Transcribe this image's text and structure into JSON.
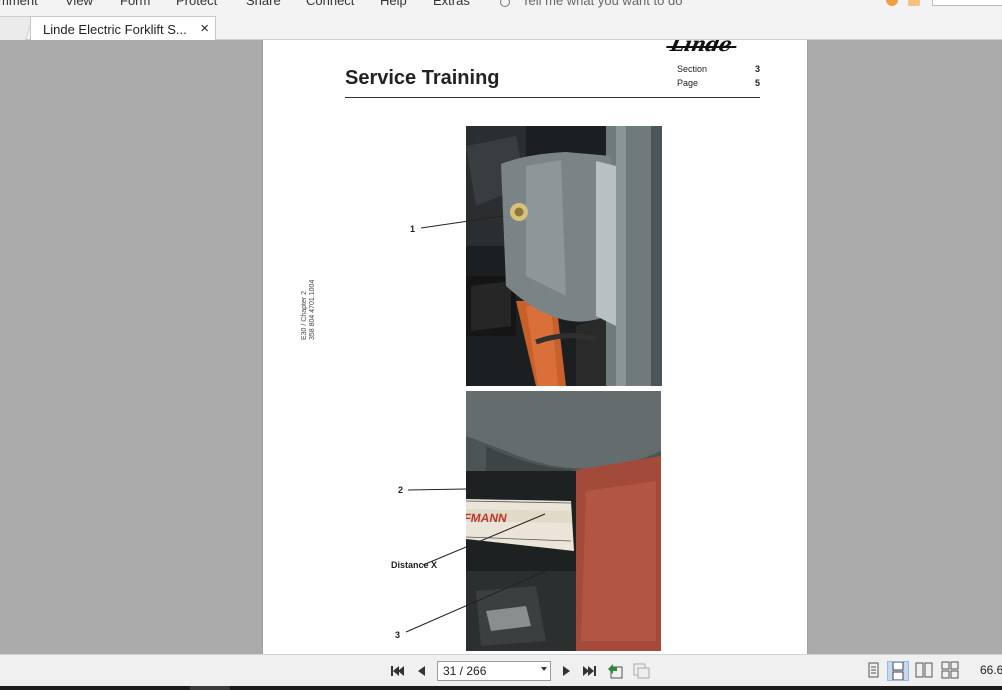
{
  "menu": {
    "items": [
      "mment",
      "View",
      "Form",
      "Protect",
      "Share",
      "Connect",
      "Help",
      "Extras"
    ],
    "tell_me": "Tell me what you want to do"
  },
  "tab": {
    "title": "Linde Electric Forklift S...",
    "close": "×"
  },
  "document": {
    "logo": "Linde",
    "title": "Service Training",
    "section_label": "Section",
    "section_value": "3",
    "page_label": "Page",
    "page_value": "5",
    "side_note_line1": "E30 / Chapter 2",
    "side_note_line2": "358 804 4701.1004",
    "callouts": {
      "c1": "1",
      "c2": "2",
      "distance": "Distance X",
      "c3": "3"
    }
  },
  "navigation": {
    "page_indicator": "31 / 266",
    "zoom": "66.6"
  },
  "colors": {
    "accent_orange": "#f0a040",
    "active_view": "#c6d9ee"
  }
}
